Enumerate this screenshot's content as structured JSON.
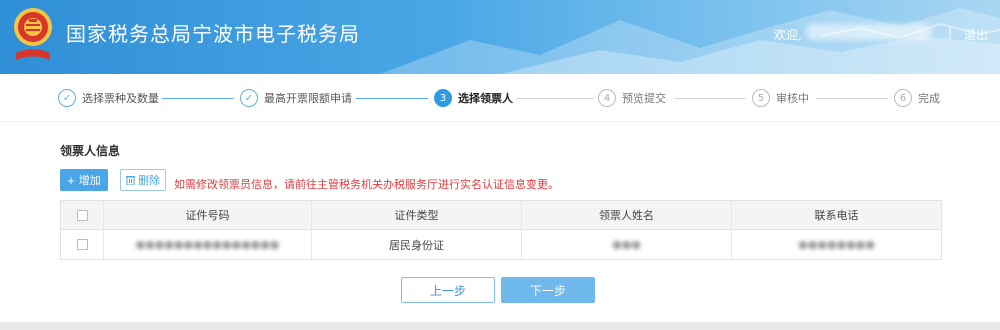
{
  "header": {
    "title": "国家税务总局宁波市电子税务局",
    "welcome": "欢迎,",
    "separator": "|",
    "logout": "退出"
  },
  "steps": [
    {
      "num": "✓",
      "label": "选择票种及数量",
      "state": "done"
    },
    {
      "num": "✓",
      "label": "最高开票限额申请",
      "state": "done"
    },
    {
      "num": "3",
      "label": "选择领票人",
      "state": "active"
    },
    {
      "num": "4",
      "label": "预览提交",
      "state": "pending"
    },
    {
      "num": "5",
      "label": "审核中",
      "state": "pending"
    },
    {
      "num": "6",
      "label": "完成",
      "state": "pending"
    }
  ],
  "section": {
    "title": "领票人信息",
    "add_label": "增加",
    "delete_label": "删除",
    "notice": "如需修改领票员信息，请前往主管税务机关办税服务厅进行实名认证信息变更。"
  },
  "table": {
    "headers": [
      "证件号码",
      "证件类型",
      "领票人姓名",
      "联系电话"
    ],
    "rows": [
      {
        "id_type": "居民身份证"
      }
    ]
  },
  "footer": {
    "prev_label": "上一步",
    "next_label": "下一步"
  },
  "colors": {
    "accent": "#2d9be0",
    "notice": "#e4393c"
  }
}
